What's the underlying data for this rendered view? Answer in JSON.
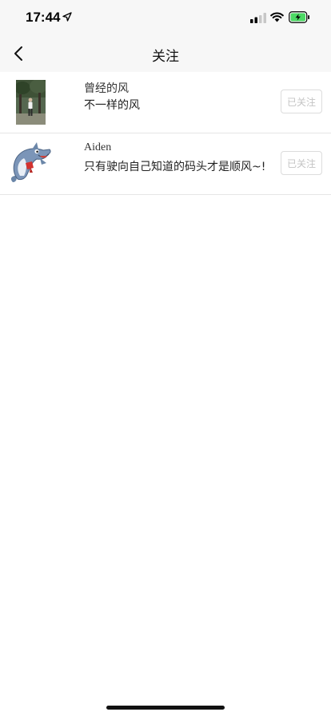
{
  "status_bar": {
    "time": "17:44",
    "battery_color": "#4cd964",
    "icons": [
      "location-arrow-icon",
      "signal-icon",
      "wifi-icon",
      "battery-charging-icon"
    ]
  },
  "nav": {
    "title": "关注",
    "back_icon": "chevron-left-icon"
  },
  "follow_list": [
    {
      "name": "曾经的风",
      "bio": "不一样的风",
      "button": "已关注",
      "avatar": "photo-avatar"
    },
    {
      "name": "Aiden",
      "bio": "只有驶向自己知道的码头才是顺风~!",
      "button": "已关注",
      "avatar": "dolphin-avatar"
    }
  ]
}
